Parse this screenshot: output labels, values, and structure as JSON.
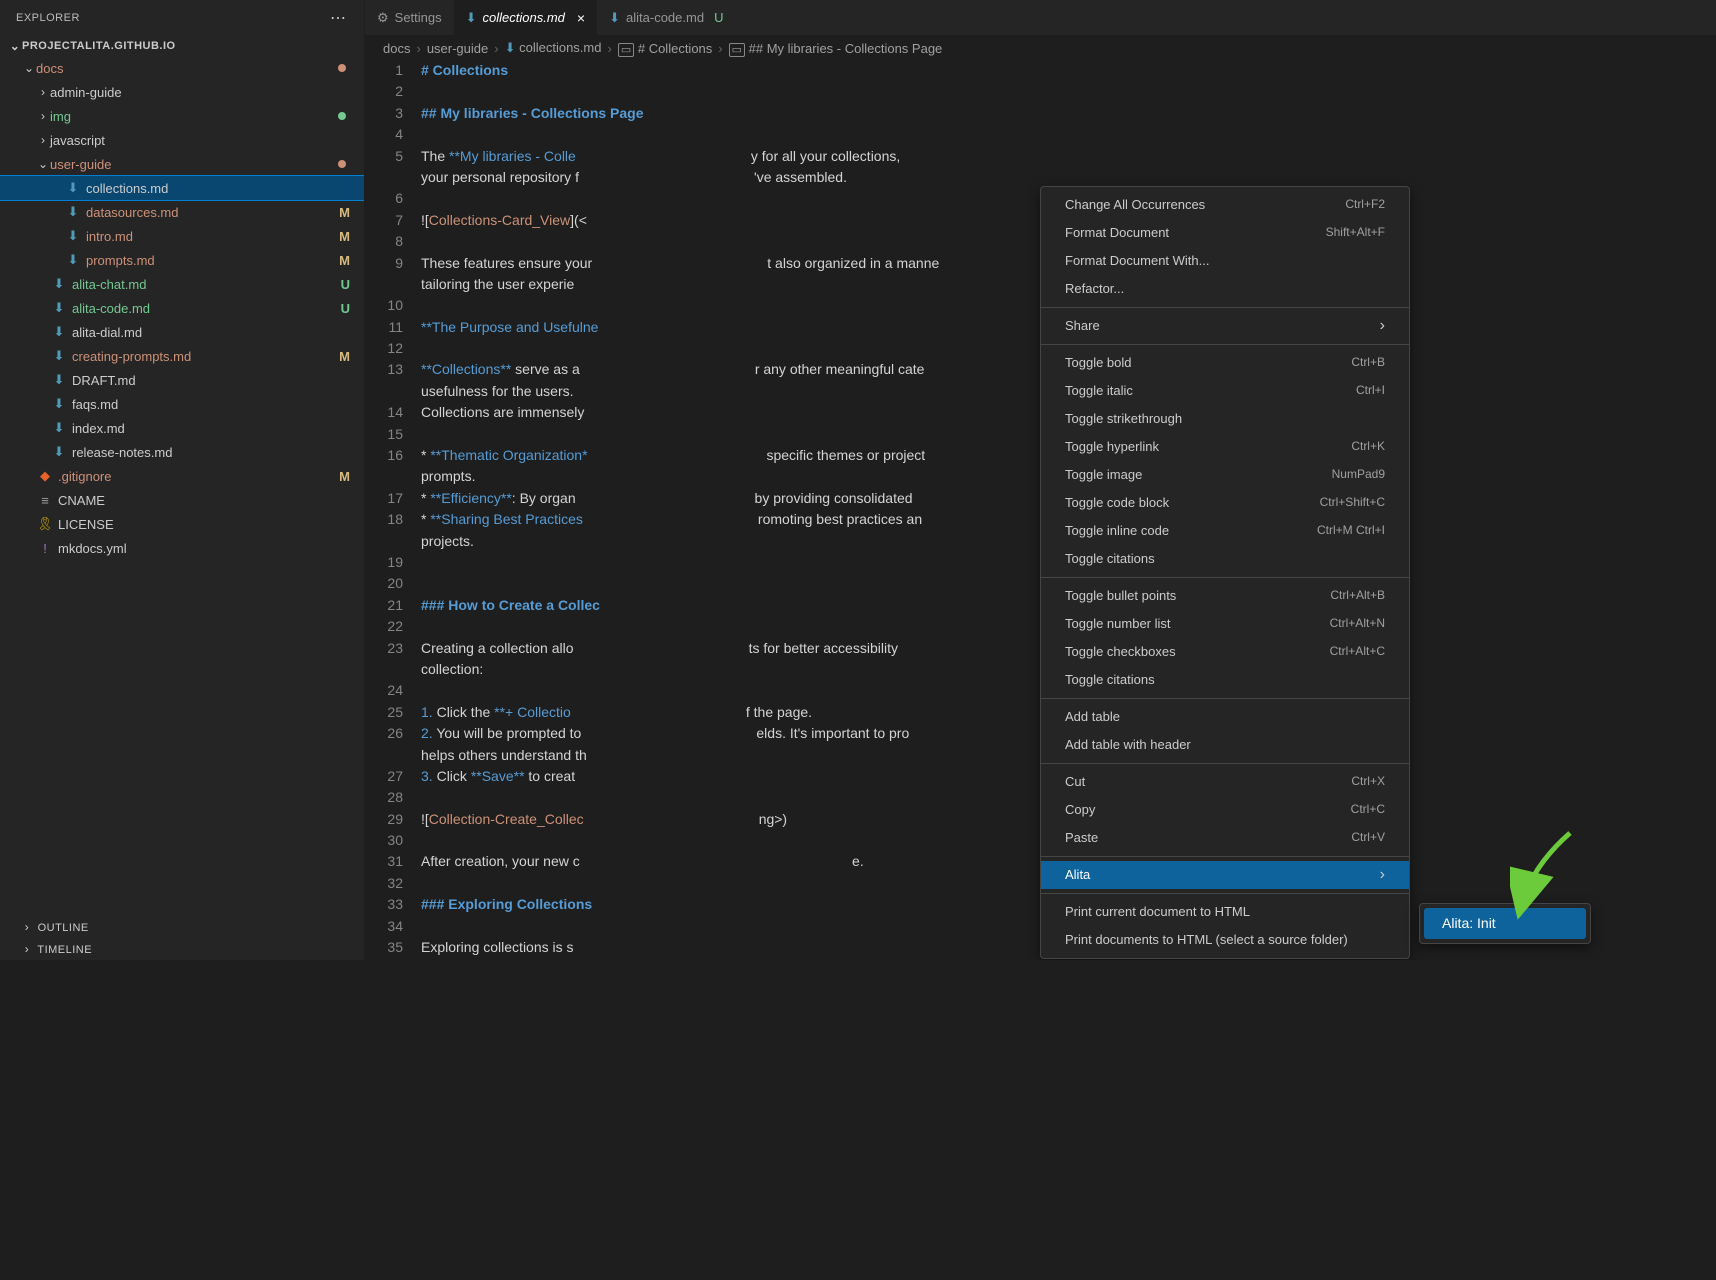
{
  "sidebar": {
    "title": "EXPLORER",
    "project": "PROJECTALITA.GITHUB.IO",
    "outline": "OUTLINE",
    "timeline": "TIMELINE",
    "tree": [
      {
        "type": "folder",
        "name": "docs",
        "depth": 1,
        "open": true,
        "color": "orange",
        "dot": "orange"
      },
      {
        "type": "folder",
        "name": "admin-guide",
        "depth": 2,
        "open": false
      },
      {
        "type": "folder",
        "name": "img",
        "depth": 2,
        "open": false,
        "color": "green",
        "dot": "green"
      },
      {
        "type": "folder",
        "name": "javascript",
        "depth": 2,
        "open": false
      },
      {
        "type": "folder",
        "name": "user-guide",
        "depth": 2,
        "open": true,
        "color": "orange",
        "dot": "orange"
      },
      {
        "type": "file",
        "name": "collections.md",
        "depth": 3,
        "ico": "md",
        "selected": true
      },
      {
        "type": "file",
        "name": "datasources.md",
        "depth": 3,
        "ico": "md",
        "color": "orange",
        "badge": "M"
      },
      {
        "type": "file",
        "name": "intro.md",
        "depth": 3,
        "ico": "md",
        "color": "orange",
        "badge": "M"
      },
      {
        "type": "file",
        "name": "prompts.md",
        "depth": 3,
        "ico": "md",
        "color": "orange",
        "badge": "M"
      },
      {
        "type": "file",
        "name": "alita-chat.md",
        "depth": 2,
        "ico": "md",
        "color": "green",
        "badge": "U"
      },
      {
        "type": "file",
        "name": "alita-code.md",
        "depth": 2,
        "ico": "md",
        "color": "green",
        "badge": "U"
      },
      {
        "type": "file",
        "name": "alita-dial.md",
        "depth": 2,
        "ico": "md"
      },
      {
        "type": "file",
        "name": "creating-prompts.md",
        "depth": 2,
        "ico": "md",
        "color": "orange",
        "badge": "M"
      },
      {
        "type": "file",
        "name": "DRAFT.md",
        "depth": 2,
        "ico": "md"
      },
      {
        "type": "file",
        "name": "faqs.md",
        "depth": 2,
        "ico": "md"
      },
      {
        "type": "file",
        "name": "index.md",
        "depth": 2,
        "ico": "md"
      },
      {
        "type": "file",
        "name": "release-notes.md",
        "depth": 2,
        "ico": "md"
      },
      {
        "type": "file",
        "name": ".gitignore",
        "depth": 1,
        "ico": "git",
        "color": "orange",
        "badge": "M"
      },
      {
        "type": "file",
        "name": "CNAME",
        "depth": 1,
        "ico": "lines"
      },
      {
        "type": "file",
        "name": "LICENSE",
        "depth": 1,
        "ico": "lic"
      },
      {
        "type": "file",
        "name": "mkdocs.yml",
        "depth": 1,
        "ico": "yml"
      }
    ]
  },
  "tabs": [
    {
      "label": "Settings",
      "icon": "gear"
    },
    {
      "label": "collections.md",
      "icon": "md",
      "active": true,
      "close": true,
      "italic": true
    },
    {
      "label": "alita-code.md",
      "icon": "md",
      "untracked": true
    }
  ],
  "breadcrumb": [
    "docs",
    "user-guide",
    "collections.md",
    "# Collections",
    "## My libraries - Collections Page"
  ],
  "code": {
    "lines": [
      {
        "n": 1,
        "t": "# Collections",
        "c": "head"
      },
      {
        "n": 2,
        "t": ""
      },
      {
        "n": 3,
        "t": "## My libraries - Collections Page",
        "c": "head"
      },
      {
        "n": 4,
        "t": ""
      },
      {
        "n": 5,
        "seg": [
          {
            "t": "The ",
            "c": "w"
          },
          {
            "t": "**My libraries - Colle",
            "c": "b"
          },
          {
            "t": "                                             ",
            "c": "w"
          },
          {
            "t": "y for all your collections,",
            "c": "w"
          }
        ]
      },
      {
        "n": "",
        "seg": [
          {
            "t": "your personal repository f",
            "c": "w"
          },
          {
            "t": "                                             ",
            "c": "w"
          },
          {
            "t": "'ve assembled.",
            "c": "w"
          }
        ]
      },
      {
        "n": 6,
        "t": ""
      },
      {
        "n": 7,
        "seg": [
          {
            "t": "![",
            "c": "w"
          },
          {
            "t": "Collections-Card_View",
            "c": "o"
          },
          {
            "t": "](<",
            "c": "w"
          }
        ]
      },
      {
        "n": 8,
        "t": ""
      },
      {
        "n": 9,
        "seg": [
          {
            "t": "These features ensure your",
            "c": "w"
          },
          {
            "t": "                                             ",
            "c": "w"
          },
          {
            "t": "t also organized in a manne",
            "c": "w"
          }
        ]
      },
      {
        "n": "",
        "seg": [
          {
            "t": "tailoring the user experie",
            "c": "w"
          }
        ]
      },
      {
        "n": 10,
        "t": ""
      },
      {
        "n": 11,
        "seg": [
          {
            "t": "**The Purpose and Usefulne",
            "c": "b"
          }
        ]
      },
      {
        "n": 12,
        "t": ""
      },
      {
        "n": 13,
        "seg": [
          {
            "t": "**Collections**",
            "c": "b"
          },
          {
            "t": " serve as a",
            "c": "w"
          },
          {
            "t": "                                             ",
            "c": "w"
          },
          {
            "t": "r any other meaningful cate",
            "c": "w"
          }
        ]
      },
      {
        "n": "",
        "seg": [
          {
            "t": "usefulness for the users. ",
            "c": "w"
          }
        ]
      },
      {
        "n": 14,
        "seg": [
          {
            "t": "Collections are immensely ",
            "c": "w"
          }
        ]
      },
      {
        "n": 15,
        "t": ""
      },
      {
        "n": 16,
        "seg": [
          {
            "t": "* ",
            "c": "w"
          },
          {
            "t": "**Thematic Organization*",
            "c": "b"
          },
          {
            "t": "                                             ",
            "c": "w"
          },
          {
            "t": " specific themes or project",
            "c": "w"
          }
        ]
      },
      {
        "n": "",
        "seg": [
          {
            "t": "prompts.",
            "c": "w"
          }
        ]
      },
      {
        "n": 17,
        "seg": [
          {
            "t": "* ",
            "c": "w"
          },
          {
            "t": "**Efficiency**",
            "c": "b"
          },
          {
            "t": ": By organ",
            "c": "w"
          },
          {
            "t": "                                             ",
            "c": "w"
          },
          {
            "t": " by providing consolidated ",
            "c": "w"
          }
        ]
      },
      {
        "n": 18,
        "seg": [
          {
            "t": "* ",
            "c": "w"
          },
          {
            "t": "**Sharing Best Practices",
            "c": "b"
          },
          {
            "t": "                                             ",
            "c": "w"
          },
          {
            "t": "romoting best practices an",
            "c": "w"
          }
        ]
      },
      {
        "n": "",
        "seg": [
          {
            "t": "projects.",
            "c": "w"
          }
        ]
      },
      {
        "n": 19,
        "t": ""
      },
      {
        "n": 20,
        "t": ""
      },
      {
        "n": 21,
        "seg": [
          {
            "t": "### How to Create a Collec",
            "c": "head"
          }
        ]
      },
      {
        "n": 22,
        "t": ""
      },
      {
        "n": 23,
        "seg": [
          {
            "t": "Creating a collection allo",
            "c": "w"
          },
          {
            "t": "                                             ",
            "c": "w"
          },
          {
            "t": "ts for better accessibility",
            "c": "w"
          }
        ]
      },
      {
        "n": "",
        "seg": [
          {
            "t": "collection:",
            "c": "w"
          }
        ]
      },
      {
        "n": 24,
        "t": ""
      },
      {
        "n": 25,
        "seg": [
          {
            "t": "1.",
            "c": "b"
          },
          {
            "t": " Click the ",
            "c": "w"
          },
          {
            "t": "**+ Collectio",
            "c": "b"
          },
          {
            "t": "                                             ",
            "c": "w"
          },
          {
            "t": "f the page.",
            "c": "w"
          }
        ]
      },
      {
        "n": 26,
        "seg": [
          {
            "t": "2.",
            "c": "b"
          },
          {
            "t": " You will be prompted to",
            "c": "w"
          },
          {
            "t": "                                             ",
            "c": "w"
          },
          {
            "t": "elds. It's important to pro",
            "c": "w"
          }
        ]
      },
      {
        "n": "",
        "seg": [
          {
            "t": "helps others understand th",
            "c": "w"
          }
        ]
      },
      {
        "n": 27,
        "seg": [
          {
            "t": "3.",
            "c": "b"
          },
          {
            "t": " Click ",
            "c": "w"
          },
          {
            "t": "**Save**",
            "c": "b"
          },
          {
            "t": " to creat",
            "c": "w"
          }
        ]
      },
      {
        "n": 28,
        "t": ""
      },
      {
        "n": 29,
        "seg": [
          {
            "t": "![",
            "c": "w"
          },
          {
            "t": "Collection-Create_Collec",
            "c": "o"
          },
          {
            "t": "                                             ",
            "c": "w"
          },
          {
            "t": "ng>)",
            "c": "w"
          }
        ]
      },
      {
        "n": 30,
        "t": ""
      },
      {
        "n": 31,
        "seg": [
          {
            "t": "After creation, your new c",
            "c": "w"
          },
          {
            "t": "                                             ",
            "c": "w"
          },
          {
            "t": "                         e.",
            "c": "w"
          }
        ]
      },
      {
        "n": 32,
        "t": ""
      },
      {
        "n": 33,
        "seg": [
          {
            "t": "### Exploring Collections",
            "c": "head"
          }
        ]
      },
      {
        "n": 34,
        "t": ""
      },
      {
        "n": 35,
        "seg": [
          {
            "t": "Exploring collections is s",
            "c": "w"
          }
        ]
      }
    ]
  },
  "ctx": [
    {
      "label": "Change All Occurrences",
      "key": "Ctrl+F2"
    },
    {
      "label": "Format Document",
      "key": "Shift+Alt+F"
    },
    {
      "label": "Format Document With..."
    },
    {
      "label": "Refactor..."
    },
    {
      "sep": true
    },
    {
      "label": "Share",
      "sub": true
    },
    {
      "sep": true
    },
    {
      "label": "Toggle bold",
      "key": "Ctrl+B"
    },
    {
      "label": "Toggle italic",
      "key": "Ctrl+I"
    },
    {
      "label": "Toggle strikethrough"
    },
    {
      "label": "Toggle hyperlink",
      "key": "Ctrl+K"
    },
    {
      "label": "Toggle image",
      "key": "NumPad9"
    },
    {
      "label": "Toggle code block",
      "key": "Ctrl+Shift+C"
    },
    {
      "label": "Toggle inline code",
      "key": "Ctrl+M Ctrl+I"
    },
    {
      "label": "Toggle citations"
    },
    {
      "sep": true
    },
    {
      "label": "Toggle bullet points",
      "key": "Ctrl+Alt+B"
    },
    {
      "label": "Toggle number list",
      "key": "Ctrl+Alt+N"
    },
    {
      "label": "Toggle checkboxes",
      "key": "Ctrl+Alt+C"
    },
    {
      "label": "Toggle citations"
    },
    {
      "sep": true
    },
    {
      "label": "Add table"
    },
    {
      "label": "Add table with header"
    },
    {
      "sep": true
    },
    {
      "label": "Cut",
      "key": "Ctrl+X"
    },
    {
      "label": "Copy",
      "key": "Ctrl+C"
    },
    {
      "label": "Paste",
      "key": "Ctrl+V"
    },
    {
      "sep": true
    },
    {
      "label": "Alita",
      "sub": true,
      "selected": true
    },
    {
      "sep": true
    },
    {
      "label": "Print current document to HTML"
    },
    {
      "label": "Print documents to HTML (select a source folder)"
    }
  ],
  "submenu": {
    "label": "Alita: Init"
  }
}
